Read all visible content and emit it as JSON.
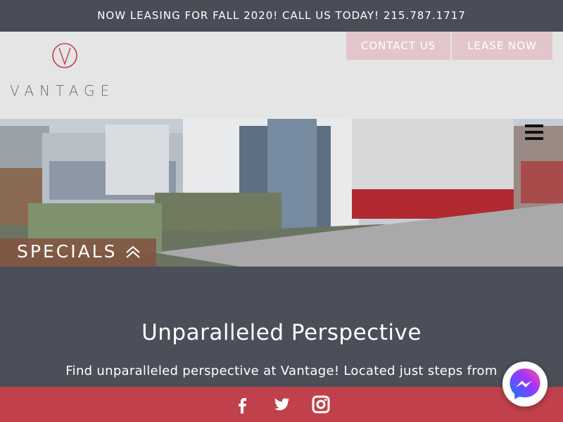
{
  "announcement": {
    "text": "NOW LEASING FOR FALL 2020! CALL US TODAY! 215.787.1717"
  },
  "header": {
    "logo_text": "VANTAGE",
    "contact_label": "CONTACT US",
    "lease_label": "LEASE NOW"
  },
  "hero": {
    "specials_label": "SPECIALS"
  },
  "main": {
    "title": "Unparalleled Perspective",
    "intro": "Find unparalleled perspective at Vantage! Located just steps from"
  },
  "footer": {
    "social_icons": [
      "facebook-icon",
      "twitter-icon",
      "instagram-icon"
    ]
  },
  "colors": {
    "announcement_bg": "#4a4d57",
    "header_bg": "#e5e5e5",
    "button_bg": "#e3c6cb",
    "accent_red": "#c0404b",
    "main_bg": "#4b4f59"
  }
}
